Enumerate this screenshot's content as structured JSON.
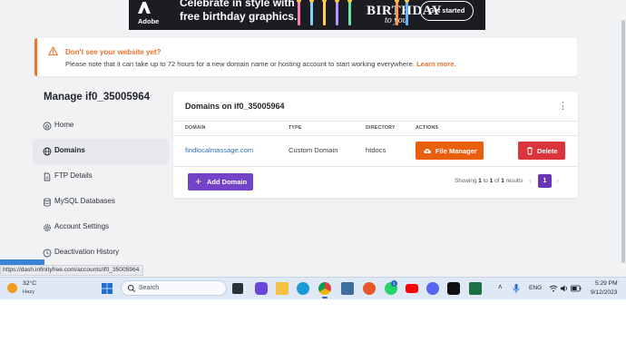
{
  "ad": {
    "brand": "Adobe",
    "line1": "Celebrate in style with",
    "line2": "free birthday graphics.",
    "headline": "BIRTHDAY",
    "script": "to you",
    "cta": "Get started"
  },
  "alert": {
    "title": "Don't see your website yet?",
    "text": "Please note that it can take up to 72 hours for a new domain name or hosting account to start working everywhere.",
    "link": "Learn more."
  },
  "sidebar": {
    "title": "Manage if0_35005964",
    "items": [
      {
        "label": "Home",
        "icon": "home-icon"
      },
      {
        "label": "Domains",
        "icon": "globe-icon",
        "active": true
      },
      {
        "label": "FTP Details",
        "icon": "file-icon"
      },
      {
        "label": "MySQL Databases",
        "icon": "database-icon"
      },
      {
        "label": "Account Settings",
        "icon": "gear-icon"
      },
      {
        "label": "Deactivation History",
        "icon": "history-icon"
      }
    ]
  },
  "panel": {
    "title": "Domains on if0_35005964",
    "columns": [
      "DOMAIN",
      "TYPE",
      "DIRECTORY",
      "ACTIONS"
    ],
    "rows": [
      {
        "domain": "findlocalmassage.com",
        "type": "Custom Domain",
        "directory": "htdocs"
      }
    ],
    "file_manager_label": "File Manager",
    "delete_label": "Delete",
    "add_label": "Add Domain",
    "showing": {
      "prefix": "Showing",
      "from": "1",
      "to_word": "to",
      "to": "1",
      "of_word": "of",
      "total": "1",
      "suffix": "results"
    },
    "page_current": "1",
    "page_prev": "‹",
    "page_next": "›"
  },
  "status_url": "https://dash.infinityfree.com/accounts/if0_35005964",
  "taskbar": {
    "weather_temp": "32°C",
    "weather_cond": "Hazy",
    "search_placeholder": "Search",
    "whatsapp_badge": "1",
    "language": "ENG",
    "time": "5:29 PM",
    "date": "9/12/2023"
  },
  "colors": {
    "accent_orange": "#e8712b",
    "brand_purple": "#7443c8",
    "delete_red": "#d9353b",
    "link_blue": "#2f6fb6"
  }
}
